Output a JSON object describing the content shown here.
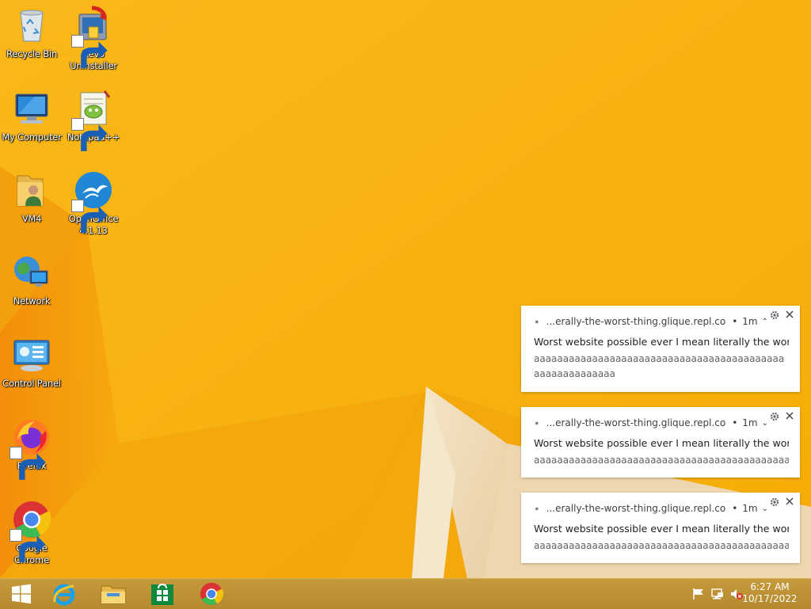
{
  "desktop": {
    "icons": [
      {
        "label": "Recycle Bin",
        "icon": "recycle-bin-icon"
      },
      {
        "label": "Revo Uninstaller",
        "icon": "revo-uninstaller-icon"
      },
      {
        "label": "My Computer",
        "icon": "my-computer-icon"
      },
      {
        "label": "Notepad++",
        "icon": "notepad-plus-plus-icon"
      },
      {
        "label": "VM4",
        "icon": "user-folder-icon"
      },
      {
        "label": "OpenOffice 4.1.13",
        "icon": "openoffice-icon"
      },
      {
        "label": "Network",
        "icon": "network-icon"
      },
      {
        "label": "Control Panel",
        "icon": "control-panel-icon"
      },
      {
        "label": "Firefox",
        "icon": "firefox-icon"
      },
      {
        "label": "Google Chrome",
        "icon": "chrome-icon"
      }
    ]
  },
  "notifications": [
    {
      "source": "...erally-the-worst-thing.glique.repl.co",
      "time": "1m",
      "chevron": "^",
      "title": "Worst website possible ever I mean literally the worst ...",
      "body": "aaaaaaaaaaaaaaaaaaaaaaaaaaaaaaaaaaaaaaaaaaaaaaaaaaaaaaaaa"
    },
    {
      "source": "...erally-the-worst-thing.glique.repl.co",
      "time": "1m",
      "chevron": "v",
      "title": "Worst website possible ever I mean literally the worst ...",
      "body": "aaaaaaaaaaaaaaaaaaaaaaaaaaaaaaaaaaaaaaaaaaaaaa..."
    },
    {
      "source": "...erally-the-worst-thing.glique.repl.co",
      "time": "1m",
      "chevron": "v",
      "title": "Worst website possible ever I mean literally the worst ...",
      "body": "aaaaaaaaaaaaaaaaaaaaaaaaaaaaaaaaaaaaaaaaaaaaaa..."
    }
  ],
  "taskbar": {
    "buttons": [
      "start-button",
      "internet-explorer",
      "file-explorer",
      "store",
      "google-chrome"
    ],
    "tray": [
      "action-center-flag-icon",
      "network-tray-icon",
      "volume-muted-icon"
    ],
    "time": "6:27 AM",
    "date": "10/17/2022"
  },
  "colors": {
    "wallpaper": "#f7b50d",
    "taskbar": "#bd9135",
    "toast_bg": "#ffffff"
  }
}
